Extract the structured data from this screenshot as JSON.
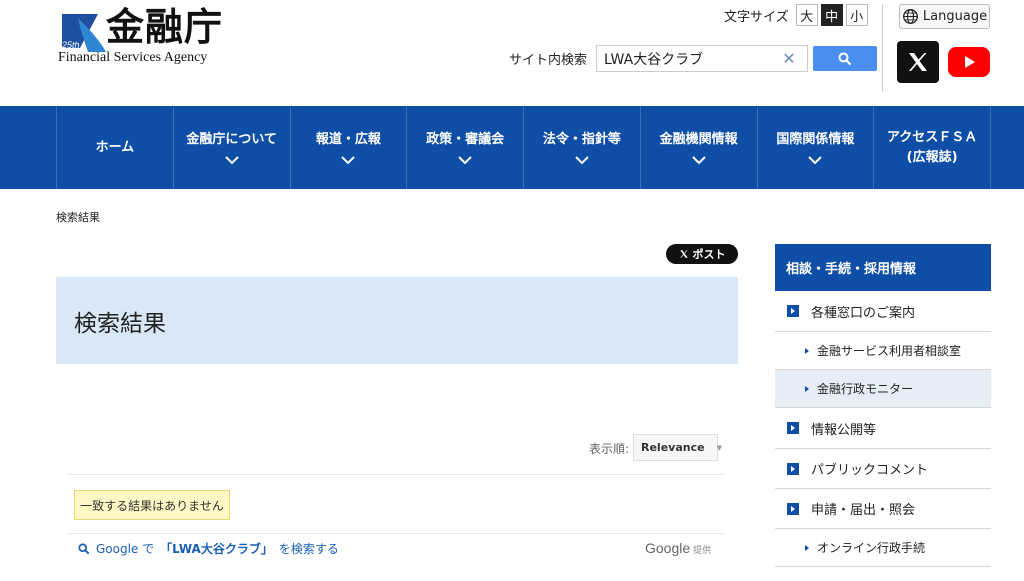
{
  "header": {
    "logo_jp": "金融庁",
    "logo_en": "Financial Services Agency",
    "logo_badge": "25th",
    "font_size_label": "文字サイズ",
    "font_sizes": [
      "大",
      "中",
      "小"
    ],
    "language_label": "Language",
    "search_label": "サイト内検索",
    "search_value": "LWA大谷クラブ"
  },
  "nav": {
    "items": [
      {
        "label": "ホーム"
      },
      {
        "label": "金融庁について"
      },
      {
        "label": "報道・広報"
      },
      {
        "label": "政策・審議会"
      },
      {
        "label": "法令・指針等"
      },
      {
        "label": "金融機関情報"
      },
      {
        "label": "国際関係情報"
      },
      {
        "label": "アクセスＦＳＡ",
        "label2": "(広報誌)"
      }
    ]
  },
  "breadcrumb": "検索結果",
  "post_label": "ポスト",
  "main": {
    "title": "検索結果",
    "sort_label": "表示順:",
    "sort_value": "Relevance",
    "no_result": "一致する結果はありません",
    "google_prefix": "Google で",
    "google_query": "「LWA大谷クラブ」",
    "google_suffix": "を検索する",
    "google_brand": "Google",
    "google_provided": "提供"
  },
  "sidebar": {
    "heading": "相談・手続・採用情報",
    "items": [
      {
        "label": "各種窓口のご案内"
      },
      {
        "label": "金融サービス利用者相談室"
      },
      {
        "label": "金融行政モニター"
      },
      {
        "label": "情報公開等"
      },
      {
        "label": "パブリックコメント"
      },
      {
        "label": "申請・届出・照会"
      },
      {
        "label": "オンライン行政手続"
      }
    ]
  },
  "colors": {
    "brand_blue": "#0e4ea6",
    "title_bg": "#d8e8f7",
    "search_button": "#4a8ef0"
  }
}
